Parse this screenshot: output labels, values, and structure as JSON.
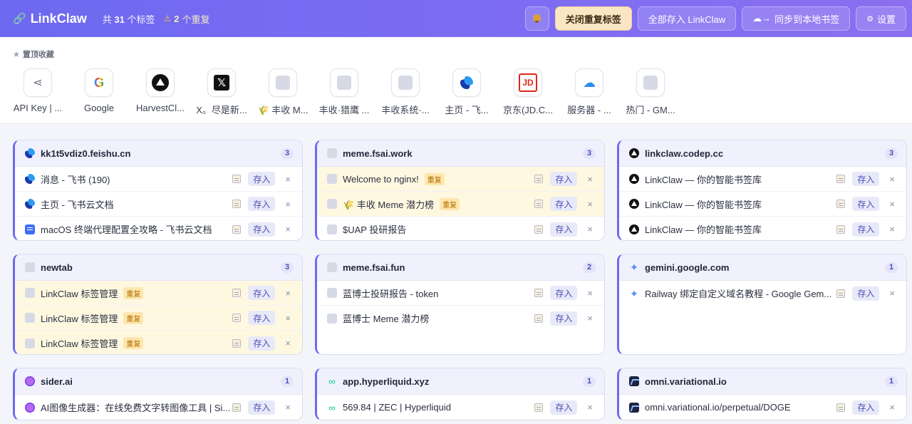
{
  "header": {
    "app_name": "LinkClaw",
    "total_prefix": "共",
    "total_count": "31",
    "total_suffix": "个标签",
    "dup_count": "2",
    "dup_suffix": "个重复",
    "close_dup_label": "关闭重复标签",
    "save_all_label": "全部存入 LinkClaw",
    "sync_label": "同步到本地书签",
    "settings_label": "设置"
  },
  "pinned": {
    "title": "置顶收藏",
    "items": [
      {
        "label": "API Key | ...",
        "icon": "share-icon"
      },
      {
        "label": "Google",
        "icon": "google-icon"
      },
      {
        "label": "HarvestCl...",
        "icon": "harvest-icon"
      },
      {
        "label": "X。尽是新...",
        "icon": "x-icon"
      },
      {
        "label": "🌾 丰收 M...",
        "icon": "blank-icon"
      },
      {
        "label": "丰收·猎鹰 ...",
        "icon": "blank-icon"
      },
      {
        "label": "丰收系统·...",
        "icon": "blank-icon"
      },
      {
        "label": "主页 - 飞...",
        "icon": "feishu-icon"
      },
      {
        "label": "京东(JD.C...",
        "icon": "jd-icon"
      },
      {
        "label": "服务器 - ...",
        "icon": "cloud-icon"
      },
      {
        "label": "热门 - GM...",
        "icon": "blank-icon"
      }
    ]
  },
  "groups": [
    {
      "domain": "kk1t5vdiz0.feishu.cn",
      "count": "3",
      "icon": "feishu-icon",
      "rows": [
        {
          "title": "消息 - 飞书 (190)",
          "icon": "feishu-icon",
          "dup": ""
        },
        {
          "title": "主页 - 飞书云文档",
          "icon": "feishu-icon",
          "dup": ""
        },
        {
          "title": "macOS 终端代理配置全攻略 - 飞书云文档",
          "icon": "doc-icon",
          "dup": ""
        }
      ]
    },
    {
      "domain": "meme.fsai.work",
      "count": "3",
      "icon": "blank-icon",
      "rows": [
        {
          "title": "Welcome to nginx!",
          "icon": "blank-icon",
          "dup": "重复"
        },
        {
          "title": "🌾 丰收 Meme 潜力榜",
          "icon": "blank-icon",
          "dup": "重复"
        },
        {
          "title": "$UAP 投研报告",
          "icon": "blank-icon",
          "dup": ""
        }
      ]
    },
    {
      "domain": "linkclaw.codep.cc",
      "count": "3",
      "icon": "harvest-icon",
      "rows": [
        {
          "title": "LinkClaw — 你的智能书签库",
          "icon": "harvest-icon",
          "dup": ""
        },
        {
          "title": "LinkClaw — 你的智能书签库",
          "icon": "harvest-icon",
          "dup": ""
        },
        {
          "title": "LinkClaw — 你的智能书签库",
          "icon": "harvest-icon",
          "dup": ""
        }
      ]
    },
    {
      "domain": "newtab",
      "count": "3",
      "icon": "blank-icon",
      "rows": [
        {
          "title": "LinkClaw 标签管理",
          "icon": "blank-icon",
          "dup": "重复"
        },
        {
          "title": "LinkClaw 标签管理",
          "icon": "blank-icon",
          "dup": "重复"
        },
        {
          "title": "LinkClaw 标签管理",
          "icon": "blank-icon",
          "dup": "重复"
        }
      ]
    },
    {
      "domain": "meme.fsai.fun",
      "count": "2",
      "icon": "blank-icon",
      "rows": [
        {
          "title": "蓝博士投研报告 - token",
          "icon": "blank-icon",
          "dup": ""
        },
        {
          "title": "蓝博士 Meme 潜力榜",
          "icon": "blank-icon",
          "dup": ""
        }
      ]
    },
    {
      "domain": "gemini.google.com",
      "count": "1",
      "icon": "gemini-icon",
      "rows": [
        {
          "title": "Railway 绑定自定义域名教程 - Google Gem...",
          "icon": "gemini-icon",
          "dup": ""
        }
      ]
    },
    {
      "domain": "sider.ai",
      "count": "1",
      "icon": "sider-icon",
      "rows": [
        {
          "title": "AI图像生成器：在线免费文字转图像工具 | Si...",
          "icon": "sider-icon",
          "dup": ""
        }
      ]
    },
    {
      "domain": "app.hyperliquid.xyz",
      "count": "1",
      "icon": "hyperliquid-icon",
      "rows": [
        {
          "title": "569.84 | ZEC | Hyperliquid",
          "icon": "hyperliquid-icon",
          "dup": ""
        }
      ]
    },
    {
      "domain": "omni.variational.io",
      "count": "1",
      "icon": "omni-icon",
      "rows": [
        {
          "title": "omni.variational.io/perpetual/DOGE",
          "icon": "omni-icon",
          "dup": ""
        }
      ]
    }
  ],
  "row_actions": {
    "save_label": "存入",
    "close_glyph": "×",
    "note_icon": "note-icon"
  },
  "colors": {
    "accent": "#6d69f0",
    "dup_bg": "#fff8e1",
    "dup_badge": "#fde7ad"
  }
}
